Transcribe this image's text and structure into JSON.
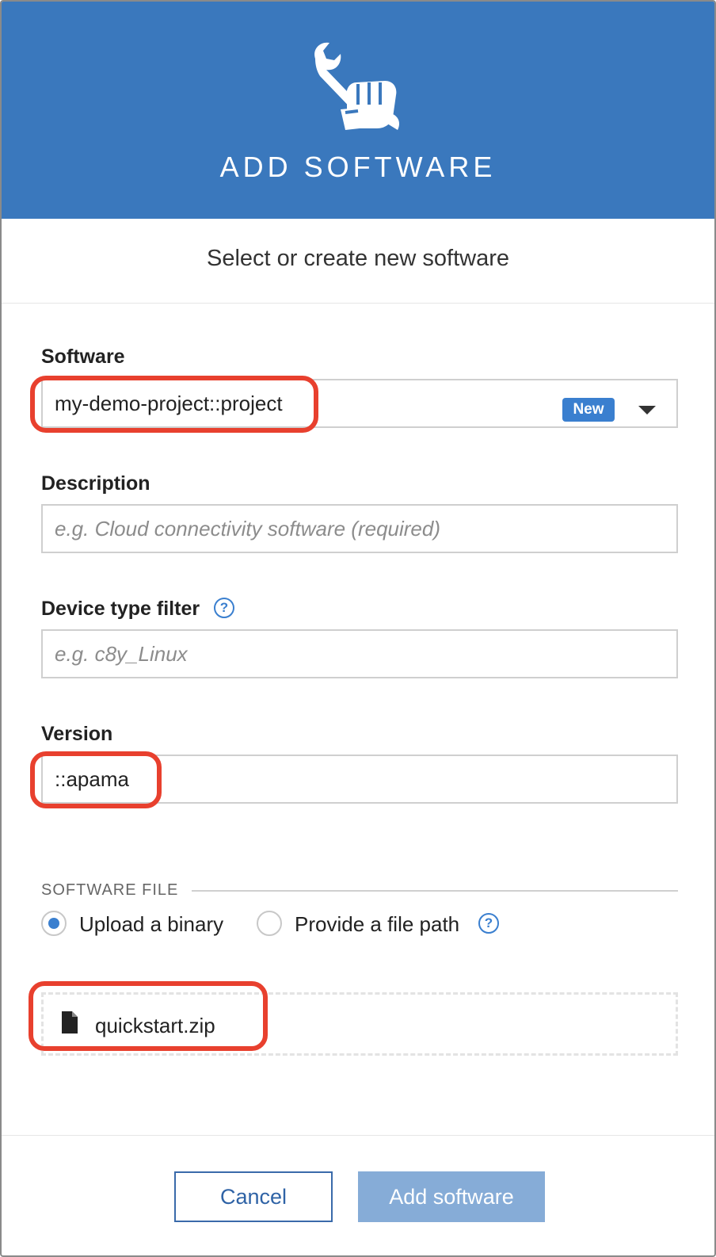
{
  "colors": {
    "accent": "#3a78bd",
    "highlight": "#e8402e",
    "badge": "#3a7fcf"
  },
  "header": {
    "icon": "wrench-hand-icon",
    "title": "ADD SOFTWARE"
  },
  "subtitle": "Select or create new software",
  "form": {
    "software": {
      "label": "Software",
      "value": "my-demo-project::project",
      "badge": "New"
    },
    "description": {
      "label": "Description",
      "placeholder": "e.g. Cloud connectivity software (required)"
    },
    "device_type_filter": {
      "label": "Device type filter",
      "placeholder": "e.g. c8y_Linux",
      "help": "?"
    },
    "version": {
      "label": "Version",
      "value": "::apama"
    }
  },
  "software_file": {
    "section_label": "SOFTWARE FILE",
    "options": [
      {
        "label": "Upload a binary",
        "selected": true
      },
      {
        "label": "Provide a file path",
        "selected": false
      }
    ],
    "help": "?",
    "file": {
      "icon": "file-icon",
      "name": "quickstart.zip"
    }
  },
  "footer": {
    "cancel_label": "Cancel",
    "add_label": "Add software"
  }
}
